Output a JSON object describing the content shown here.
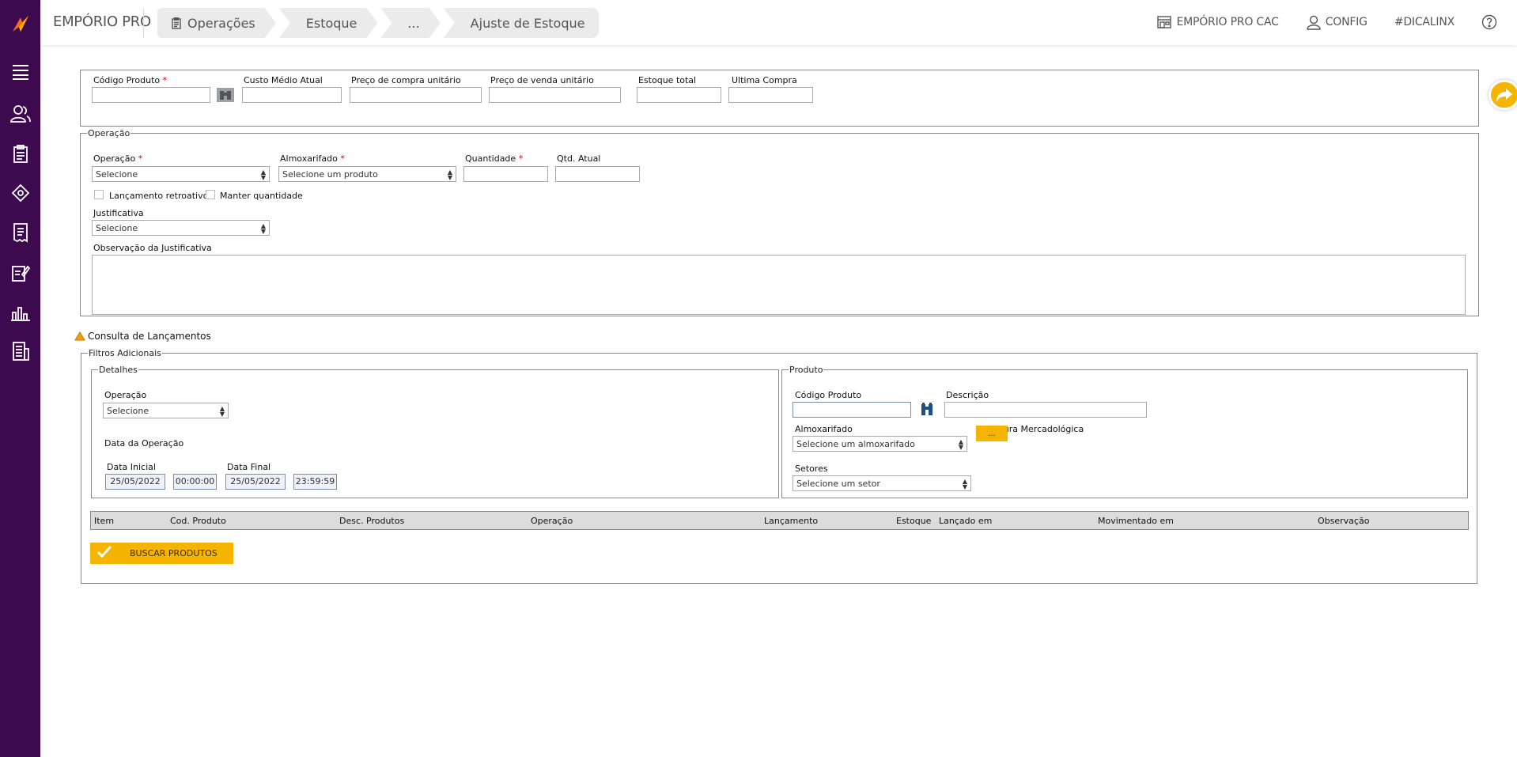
{
  "app": {
    "title": "EMPÓRIO PRO"
  },
  "breadcrumb": [
    "Operações",
    "Estoque",
    "...",
    "Ajuste de Estoque"
  ],
  "toplinks": {
    "cac": "EMPÓRIO PRO CAC",
    "config": "CONFIG",
    "dica": "#DICALINX"
  },
  "produto_header": {
    "codigo_label": "Código Produto",
    "custo_label": "Custo Médio Atual",
    "preco_compra_label": "Preço de compra unitário",
    "preco_venda_label": "Preço de venda unitário",
    "estoque_label": "Estoque total",
    "ultima_label": "Ultima Compra"
  },
  "operacao": {
    "legend": "Operação",
    "operacao_label": "Operação",
    "operacao_value": "Selecione",
    "almox_label": "Almoxarifado",
    "almox_value": "Selecione um produto",
    "quantidade_label": "Quantidade",
    "qtd_atual_label": "Qtd. Atual",
    "retroativo_label": "Lançamento retroativo",
    "manter_label": "Manter quantidade",
    "justificativa_label": "Justificativa",
    "justificativa_value": "Selecione",
    "obs_label": "Observação da Justificativa"
  },
  "consulta": {
    "title": "Consulta de Lançamentos",
    "filtros_legend": "Filtros Adicionais",
    "detalhes_legend": "Detalhes",
    "operacao_label": "Operação",
    "operacao_value": "Selecione",
    "data_operacao_label": "Data da Operação",
    "data_inicial_label": "Data Inicial",
    "data_inicial": "25/05/2022",
    "hora_inicial": "00:00:00",
    "data_final_label": "Data Final",
    "data_final": "25/05/2022",
    "hora_final": "23:59:59",
    "produto_legend": "Produto",
    "codigo_label": "Código Produto",
    "descricao_label": "Descrição",
    "almox_label": "Almoxarifado",
    "almox_value": "Selecione um almoxarifado",
    "estrutura_label": "Estrutura Mercadológica",
    "estrutura_btn": "...",
    "setores_label": "Setores",
    "setores_value": "Selecione um setor"
  },
  "grid_columns": [
    "Item",
    "Cod. Produto",
    "Desc. Produtos",
    "Operação",
    "Lançamento",
    "Estoque",
    "Lançado em",
    "Movimentado em",
    "Observação"
  ],
  "buscar_label": "BUSCAR PRODUTOS",
  "colors": {
    "sidebar": "#3d0a4f",
    "accent": "#f5b400",
    "logo": "#f26c21"
  }
}
